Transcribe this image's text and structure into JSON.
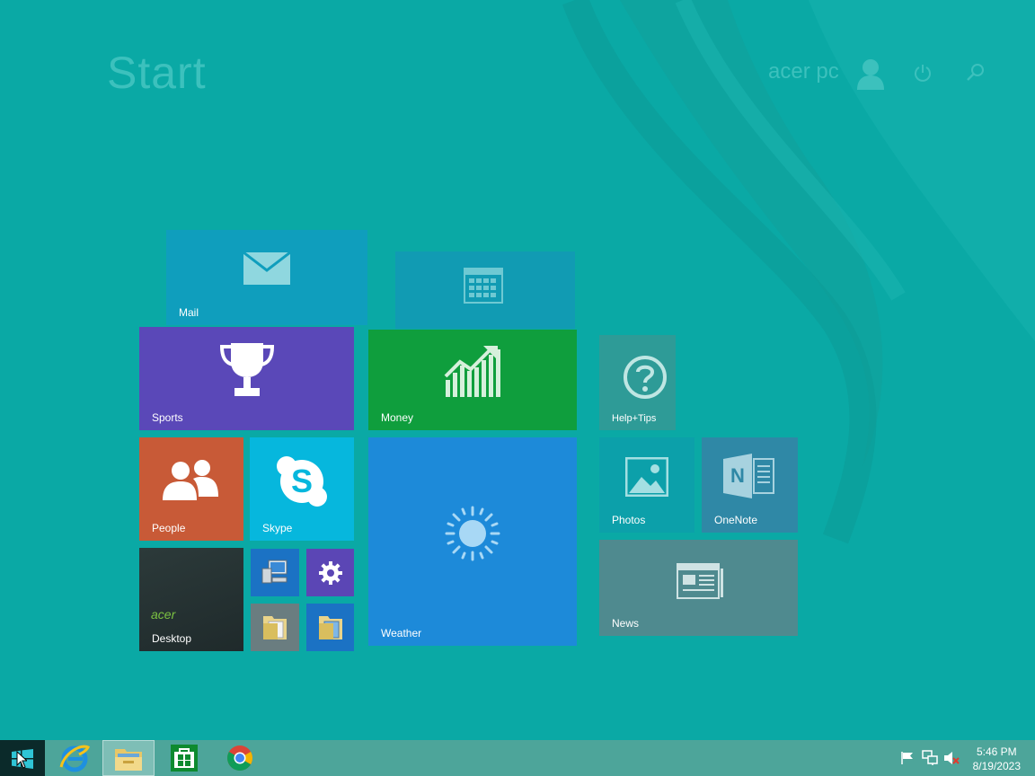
{
  "header": {
    "title": "Start",
    "user_name": "acer pc",
    "icons": [
      "user-icon",
      "power-icon",
      "search-icon"
    ]
  },
  "tiles": {
    "mail": {
      "label": "Mail",
      "icon": "mail-icon",
      "color": "#0f9ebd"
    },
    "calendar": {
      "label": "",
      "icon": "calendar-icon",
      "color": "#119bb3"
    },
    "sports": {
      "label": "Sports",
      "icon": "trophy-icon",
      "color": "#5a48b8"
    },
    "money": {
      "label": "Money",
      "icon": "chart-up-icon",
      "color": "#0f9e3d"
    },
    "help": {
      "label": "Help+Tips",
      "icon": "question-icon",
      "color": "#2e9b97"
    },
    "people": {
      "label": "People",
      "icon": "people-icon",
      "color": "#c85a37"
    },
    "skype": {
      "label": "Skype",
      "icon": "skype-icon",
      "color": "#06b7dd"
    },
    "weather": {
      "label": "Weather",
      "icon": "sun-icon",
      "color": "#1d8ad9"
    },
    "photos": {
      "label": "Photos",
      "icon": "photo-icon",
      "color": "#0ca0aa"
    },
    "onenote": {
      "label": "OneNote",
      "icon": "onenote-icon",
      "color": "#2f88a6"
    },
    "desktop": {
      "label": "Desktop",
      "brand": "acer",
      "color": "#2a3535"
    },
    "this_pc": {
      "label": "",
      "icon": "computer-icon",
      "color": "#1b72c4"
    },
    "settings": {
      "label": "",
      "icon": "gear-icon",
      "color": "#5b46b5"
    },
    "folder1": {
      "label": "",
      "icon": "folder-icon",
      "color": "#6a7d80"
    },
    "folder2": {
      "label": "",
      "icon": "folder-icon",
      "color": "#1b72c4"
    },
    "news": {
      "label": "News",
      "icon": "news-icon",
      "color": "#4f8a8f"
    }
  },
  "taskbar": {
    "apps": [
      "windows-start-icon",
      "internet-explorer-icon",
      "file-explorer-icon",
      "store-icon",
      "chrome-icon"
    ],
    "tray_icons": [
      "action-center-flag-icon",
      "network-icon",
      "volume-muted-icon"
    ],
    "time": "5:46 PM",
    "date": "8/19/2023"
  }
}
